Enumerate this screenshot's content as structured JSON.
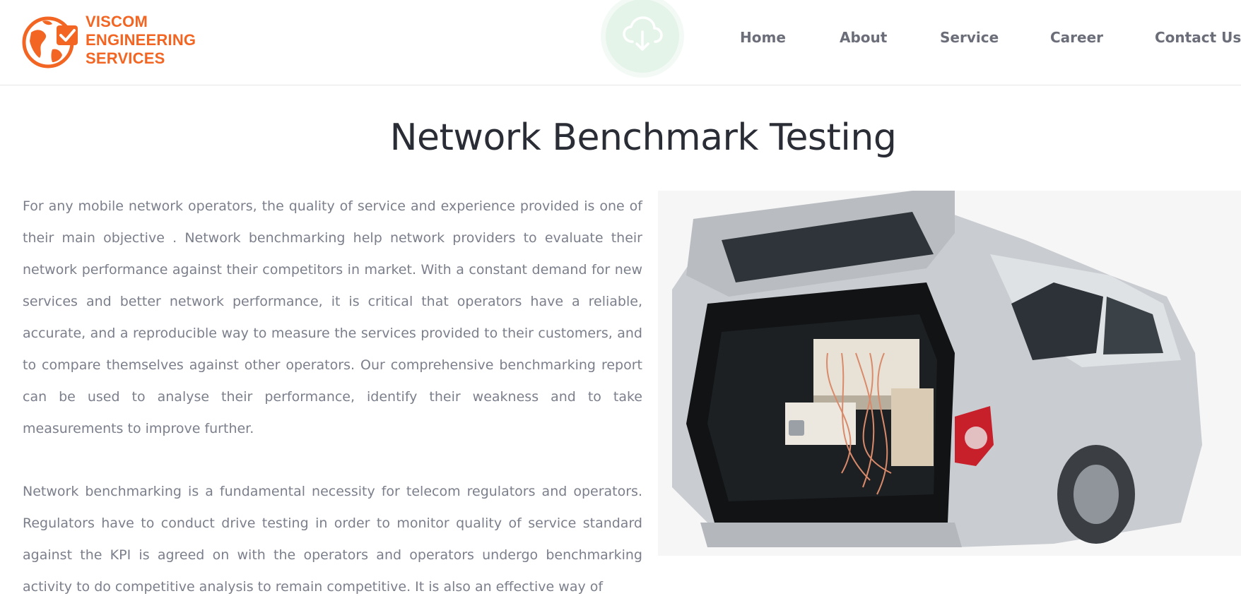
{
  "brand": {
    "line1": "VISCOM",
    "line2": "ENGINEERING",
    "line3": "SERVICES",
    "color": "#f26522"
  },
  "header": {
    "download_icon": "cloud-download-icon"
  },
  "nav": {
    "home": "Home",
    "about": "About",
    "service": "Service",
    "career": "Career",
    "contact": "Contact Us"
  },
  "page": {
    "title": "Network Benchmark Testing",
    "paragraphs": [
      "For any mobile network operators, the quality of service and experience provided is one of their main objective . Network benchmarking help network providers to evaluate their network performance against their competitors in market. With a constant demand for new services and better network performance, it is critical that operators have a reliable, accurate, and a reproducible way to measure the services provided to their customers, and to compare themselves against other operators. Our comprehensive benchmarking report can be used to analyse their performance, identify their weakness and to take measurements to improve further.",
      "Network benchmarking is a fundamental necessity for telecom regulators and operators. Regulators have to conduct drive testing in order to monitor quality of service standard against the KPI is agreed on with the operators and operators undergo benchmarking activity to do competitive analysis to remain competitive. It is also an effective way of"
    ]
  },
  "colors": {
    "title": "#2a2d35",
    "body_text": "#7b7f8b",
    "nav_text": "#6b6e79",
    "cloud_button": "#e4f4e9"
  }
}
